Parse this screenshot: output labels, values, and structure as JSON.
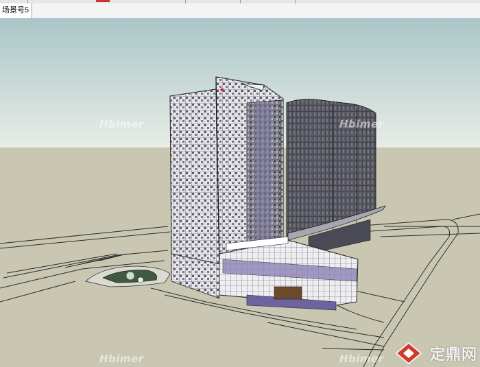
{
  "app": {
    "scene_tab_label": "场景号5"
  },
  "watermarks": {
    "left_top": "Hbimer",
    "right_top": "Hbimer",
    "left_bottom": "Hbimer",
    "center_bottom": "Hbimer"
  },
  "brand": {
    "name": "定鼎网",
    "logo_icon": "house-diamond-icon",
    "logo_color": "#d23a2a"
  },
  "colors": {
    "sky_top": "#a9c6c8",
    "sky_bottom": "#e7ebe6",
    "ground": "#c9c7b2",
    "glass": "#6f6f7a",
    "accent_purple": "#8d82b8"
  }
}
